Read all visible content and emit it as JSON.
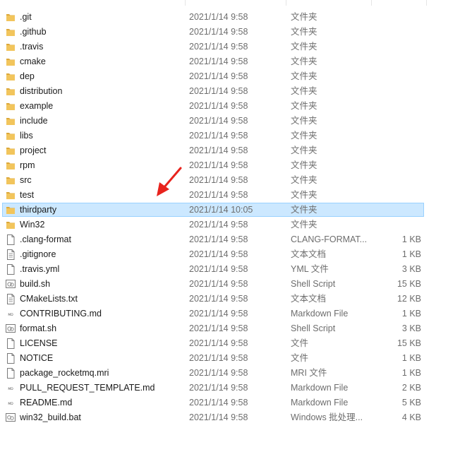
{
  "files": [
    {
      "name": ".git",
      "date": "2021/1/14 9:58",
      "type": "文件夹",
      "size": "",
      "icon": "folder-icon"
    },
    {
      "name": ".github",
      "date": "2021/1/14 9:58",
      "type": "文件夹",
      "size": "",
      "icon": "folder-icon"
    },
    {
      "name": ".travis",
      "date": "2021/1/14 9:58",
      "type": "文件夹",
      "size": "",
      "icon": "folder-icon"
    },
    {
      "name": "cmake",
      "date": "2021/1/14 9:58",
      "type": "文件夹",
      "size": "",
      "icon": "folder-icon"
    },
    {
      "name": "dep",
      "date": "2021/1/14 9:58",
      "type": "文件夹",
      "size": "",
      "icon": "folder-icon"
    },
    {
      "name": "distribution",
      "date": "2021/1/14 9:58",
      "type": "文件夹",
      "size": "",
      "icon": "folder-icon"
    },
    {
      "name": "example",
      "date": "2021/1/14 9:58",
      "type": "文件夹",
      "size": "",
      "icon": "folder-icon"
    },
    {
      "name": "include",
      "date": "2021/1/14 9:58",
      "type": "文件夹",
      "size": "",
      "icon": "folder-icon"
    },
    {
      "name": "libs",
      "date": "2021/1/14 9:58",
      "type": "文件夹",
      "size": "",
      "icon": "folder-icon"
    },
    {
      "name": "project",
      "date": "2021/1/14 9:58",
      "type": "文件夹",
      "size": "",
      "icon": "folder-icon"
    },
    {
      "name": "rpm",
      "date": "2021/1/14 9:58",
      "type": "文件夹",
      "size": "",
      "icon": "folder-icon"
    },
    {
      "name": "src",
      "date": "2021/1/14 9:58",
      "type": "文件夹",
      "size": "",
      "icon": "folder-icon"
    },
    {
      "name": "test",
      "date": "2021/1/14 9:58",
      "type": "文件夹",
      "size": "",
      "icon": "folder-icon"
    },
    {
      "name": "thirdparty",
      "date": "2021/1/14 10:05",
      "type": "文件夹",
      "size": "",
      "icon": "folder-icon",
      "selected": true
    },
    {
      "name": "Win32",
      "date": "2021/1/14 9:58",
      "type": "文件夹",
      "size": "",
      "icon": "folder-icon"
    },
    {
      "name": ".clang-format",
      "date": "2021/1/14 9:58",
      "type": "CLANG-FORMAT...",
      "size": "1 KB",
      "icon": "blank-file-icon"
    },
    {
      "name": ".gitignore",
      "date": "2021/1/14 9:58",
      "type": "文本文档",
      "size": "1 KB",
      "icon": "text-file-icon"
    },
    {
      "name": ".travis.yml",
      "date": "2021/1/14 9:58",
      "type": "YML 文件",
      "size": "3 KB",
      "icon": "blank-file-icon"
    },
    {
      "name": "build.sh",
      "date": "2021/1/14 9:58",
      "type": "Shell Script",
      "size": "15 KB",
      "icon": "script-file-icon"
    },
    {
      "name": "CMakeLists.txt",
      "date": "2021/1/14 9:58",
      "type": "文本文档",
      "size": "12 KB",
      "icon": "text-file-icon"
    },
    {
      "name": "CONTRIBUTING.md",
      "date": "2021/1/14 9:58",
      "type": "Markdown File",
      "size": "1 KB",
      "icon": "markdown-file-icon"
    },
    {
      "name": "format.sh",
      "date": "2021/1/14 9:58",
      "type": "Shell Script",
      "size": "3 KB",
      "icon": "script-file-icon"
    },
    {
      "name": "LICENSE",
      "date": "2021/1/14 9:58",
      "type": "文件",
      "size": "15 KB",
      "icon": "blank-file-icon"
    },
    {
      "name": "NOTICE",
      "date": "2021/1/14 9:58",
      "type": "文件",
      "size": "1 KB",
      "icon": "blank-file-icon"
    },
    {
      "name": "package_rocketmq.mri",
      "date": "2021/1/14 9:58",
      "type": "MRI 文件",
      "size": "1 KB",
      "icon": "blank-file-icon"
    },
    {
      "name": "PULL_REQUEST_TEMPLATE.md",
      "date": "2021/1/14 9:58",
      "type": "Markdown File",
      "size": "2 KB",
      "icon": "markdown-file-icon"
    },
    {
      "name": "README.md",
      "date": "2021/1/14 9:58",
      "type": "Markdown File",
      "size": "5 KB",
      "icon": "markdown-file-icon"
    },
    {
      "name": "win32_build.bat",
      "date": "2021/1/14 9:58",
      "type": "Windows 批处理...",
      "size": "4 KB",
      "icon": "batch-file-icon"
    }
  ],
  "colors": {
    "folder": "#f2c55c",
    "folder_dark": "#dca83a",
    "selection_bg": "#cce8ff",
    "selection_border": "#99d1ff",
    "annotation_arrow": "#e8231d",
    "muted_text": "#6d6d6d"
  },
  "annotation": {
    "type": "arrow",
    "target": "thirdparty",
    "icon": "red-arrow-icon"
  }
}
